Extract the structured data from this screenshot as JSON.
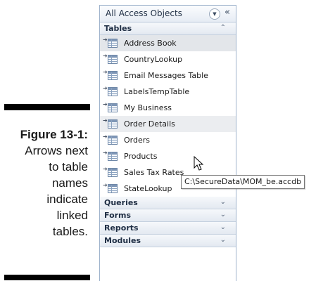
{
  "caption": {
    "figure_number": "Figure 13-1:",
    "lines": [
      "Arrows next",
      "to table",
      "names",
      "indicate",
      "linked",
      "tables."
    ]
  },
  "nav_pane": {
    "title": "All Access Objects",
    "dropdown_icon": "chevron-down-circle-icon",
    "close_icon": "double-chevron-left-icon",
    "tables_group": {
      "label": "Tables",
      "state": "expanded",
      "items": [
        {
          "label": "Address Book",
          "linked": true,
          "state": "selected"
        },
        {
          "label": "CountryLookup",
          "linked": true
        },
        {
          "label": "Email Messages Table",
          "linked": true
        },
        {
          "label": "LabelsTempTable",
          "linked": true
        },
        {
          "label": "My Business",
          "linked": true
        },
        {
          "label": "Order Details",
          "linked": true,
          "state": "hover"
        },
        {
          "label": "Orders",
          "linked": true
        },
        {
          "label": "Products",
          "linked": true
        },
        {
          "label": "Sales Tax Rates",
          "linked": true
        },
        {
          "label": "StateLookup",
          "linked": true
        }
      ]
    },
    "collapsed_groups": [
      {
        "label": "Queries"
      },
      {
        "label": "Forms"
      },
      {
        "label": "Reports"
      },
      {
        "label": "Modules"
      }
    ]
  },
  "tooltip": {
    "text": "C:\\SecureData\\MOM_be.accdb"
  },
  "colors": {
    "pane_border": "#9fb3cc",
    "selected_row": "#e3e6ea",
    "group_header": "#e3e9f1"
  }
}
